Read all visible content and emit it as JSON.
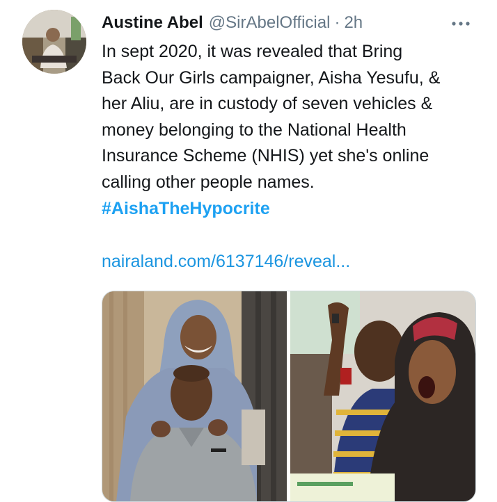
{
  "tweet": {
    "author": {
      "display_name": "Austine Abel",
      "handle": "@SirAbelOfficial",
      "separator": "·",
      "time": "2h",
      "avatar_icon": "profile-photo"
    },
    "more_icon": "more-horizontal-icon",
    "text_lines": [
      "In sept 2020, it was revealed that Bring",
      "Back Our Girls campaigner, Aisha Yesufu, &",
      "her Aliu, are in custody of seven vehicles &",
      "money belonging to the National Health",
      "Insurance Scheme (NHIS) yet she's online",
      "calling other people names."
    ],
    "hashtag": "#AishaTheHypocrite",
    "link": "nairaland.com/6137146/reveal...",
    "media": [
      {
        "name": "photo-couple-portrait"
      },
      {
        "name": "photo-protest-shouting-woman"
      }
    ],
    "colors": {
      "text": "#14171a",
      "secondary": "#657786",
      "hashtag": "#1da1f2",
      "link": "#1b95e0",
      "border": "#cfd9de"
    }
  }
}
